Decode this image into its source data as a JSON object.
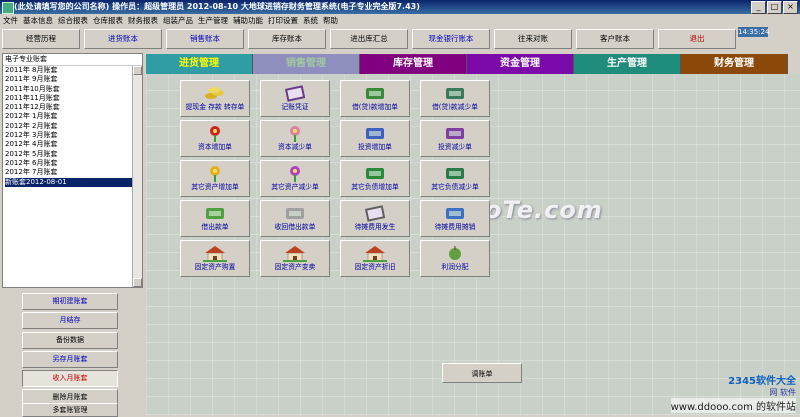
{
  "window": {
    "title": "(此处请填写您的公司名称)    操作员：超级管理员    2012-08-10    大地球进销存财务管理系统(电子专业完全版7.43)",
    "min_label": "_",
    "max_label": "□",
    "close_label": "×"
  },
  "menu": [
    "文件",
    "基本信息",
    "综合报表",
    "仓库报表",
    "财务报表",
    "组装产品",
    "生产管理",
    "辅助功能",
    "打印设置",
    "系统",
    "帮助"
  ],
  "toolbar": {
    "buttons": [
      {
        "label": "经营历程",
        "style": "k"
      },
      {
        "label": "进货账本",
        "style": "blue"
      },
      {
        "label": "销售账本",
        "style": "blue"
      },
      {
        "label": "库存账本",
        "style": "k"
      },
      {
        "label": "进出库汇总",
        "style": "k"
      },
      {
        "label": "现金银行账本",
        "style": "blue"
      },
      {
        "label": "往来对账",
        "style": "k"
      },
      {
        "label": "客户账本",
        "style": "k"
      },
      {
        "label": "退出",
        "style": "red"
      }
    ],
    "clock": "14:35:24"
  },
  "tree": {
    "header": "电子专业账套",
    "items": [
      "2011年 8月账套",
      "2011年 9月账套",
      "2011年10月账套",
      "2011年11月账套",
      "2011年12月账套",
      "2012年 1月账套",
      "2012年 2月账套",
      "2012年 3月账套",
      "2012年 4月账套",
      "2012年 5月账套",
      "2012年 6月账套",
      "2012年 7月账套",
      "新账套2012-08-01"
    ],
    "selected_index": 12
  },
  "left_buttons": [
    {
      "label": "期初建账套",
      "style": "blue"
    },
    {
      "label": "月结存",
      "style": "blue"
    },
    {
      "label": "备份数据",
      "style": "k"
    },
    {
      "label": "另存月账套",
      "style": "blue"
    },
    {
      "label": "收入月账套",
      "style": "red"
    },
    {
      "label": "删除月账套",
      "style": "k"
    },
    {
      "label": "多套账管理",
      "style": "k"
    }
  ],
  "tabs": [
    {
      "label": "进货管理",
      "color": "#2f9da3",
      "text": "#ffff00"
    },
    {
      "label": "销售管理",
      "color": "#8f8fbf",
      "text": "#a0c8a0"
    },
    {
      "label": "库存管理",
      "color": "#800080",
      "text": "#ffffff"
    },
    {
      "label": "资金管理",
      "color": "#7b0aa8",
      "text": "#ffffff"
    },
    {
      "label": "生产管理",
      "color": "#1f8c7c",
      "text": "#ffffff"
    },
    {
      "label": "财务管理",
      "color": "#8b4a0a",
      "text": "#ffffff"
    }
  ],
  "functions": [
    {
      "label": "提现金 存款 转存单",
      "icon": "gold-coins-icon",
      "color": "#d8b020"
    },
    {
      "label": "记账凭证",
      "icon": "ledger-book-icon",
      "color": "#6a3a8a"
    },
    {
      "label": "借(贷)款增加单",
      "icon": "money-hand-icon",
      "color": "#3a8a3a"
    },
    {
      "label": "借(贷)款减少单",
      "icon": "money-bundle-icon",
      "color": "#3a7a5a"
    },
    {
      "label": "资本增加单",
      "icon": "red-flower-icon",
      "color": "#d02020"
    },
    {
      "label": "资本减少单",
      "icon": "pink-flower-icon",
      "color": "#e080a0"
    },
    {
      "label": "投资增加单",
      "icon": "blue-figure-icon",
      "color": "#4060c0"
    },
    {
      "label": "投资减少单",
      "icon": "purple-figure-icon",
      "color": "#8040a0"
    },
    {
      "label": "其它资产增加单",
      "icon": "yellow-flowers-icon",
      "color": "#e0b020"
    },
    {
      "label": "其它资产减少单",
      "icon": "violet-flowers-icon",
      "color": "#b040c0"
    },
    {
      "label": "其它负债增加单",
      "icon": "money-hand-icon",
      "color": "#2a8a3a"
    },
    {
      "label": "其它负债减少单",
      "icon": "money-bundle-icon",
      "color": "#2a7a4a"
    },
    {
      "label": "借出款单",
      "icon": "potted-plant-icon",
      "color": "#50a040"
    },
    {
      "label": "收回借出款单",
      "icon": "rabbit-icon",
      "color": "#a0a0a0"
    },
    {
      "label": "待摊费用发生",
      "icon": "open-book-icon",
      "color": "#606060"
    },
    {
      "label": "待摊费用摊销",
      "icon": "pen-paper-icon",
      "color": "#4070c0"
    },
    {
      "label": "固定资产购置",
      "icon": "house-icon",
      "color": "#c04020"
    },
    {
      "label": "固定资产变卖",
      "icon": "house-icon",
      "color": "#c04020"
    },
    {
      "label": "固定资产折旧",
      "icon": "house-icon",
      "color": "#c04020"
    },
    {
      "label": "利润分配",
      "icon": "apple-icon",
      "color": "#60a040"
    }
  ],
  "adjust_button": "调账单",
  "watermark": {
    "main": "DuoTe.com",
    "site1": "2345软件大全",
    "site2": "网 软件",
    "site3": "www.ddooo.com 的软件站"
  }
}
